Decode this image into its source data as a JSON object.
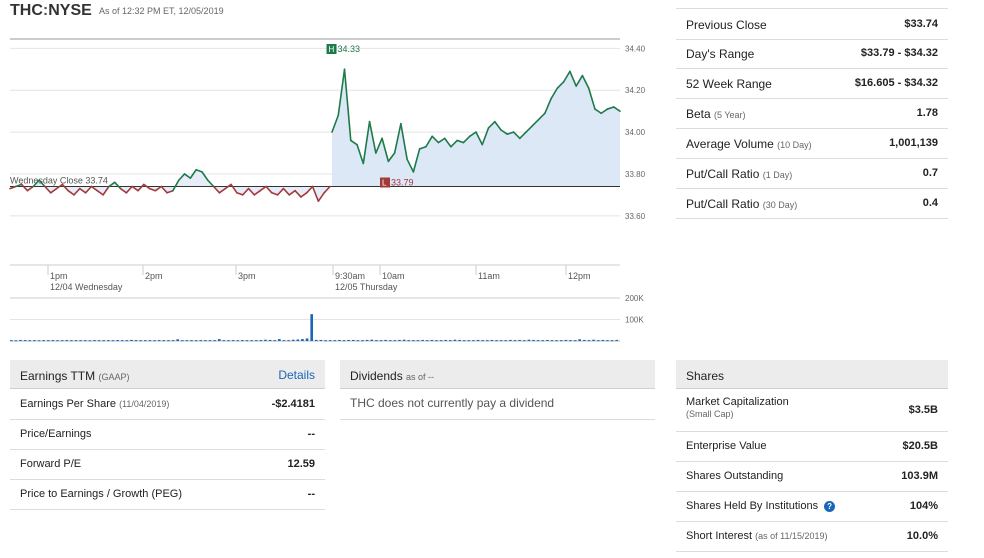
{
  "header": {
    "symbol": "THC",
    "separator": ":",
    "exchange": "NYSE",
    "as_of": "As of 12:32 PM ET, 12/05/2019"
  },
  "chart_data": {
    "type": "line",
    "title": "",
    "y_ticks": [
      "34.40",
      "34.20",
      "34.00",
      "33.80",
      "33.60"
    ],
    "ylim": [
      33.58,
      34.44
    ],
    "previous_close": 33.74,
    "previous_close_label": "Wednesday Close 33.74",
    "high_label": "34.33",
    "high_marker": "H",
    "low_label": "33.79",
    "low_marker": "L",
    "x_labels": [
      {
        "time": "1pm",
        "sub": "12/04 Wednesday"
      },
      {
        "time": "2pm",
        "sub": ""
      },
      {
        "time": "3pm",
        "sub": ""
      },
      {
        "time": "9:30am",
        "sub": "12/05 Thursday"
      },
      {
        "time": "10am",
        "sub": ""
      },
      {
        "time": "11am",
        "sub": ""
      },
      {
        "time": "12pm",
        "sub": ""
      }
    ],
    "series": [
      {
        "values": [
          33.73,
          33.74,
          33.75,
          33.72,
          33.74,
          33.77,
          33.74,
          33.71,
          33.73,
          33.75,
          33.72,
          33.7,
          33.73,
          33.71,
          33.74,
          33.72,
          33.7,
          33.74,
          33.76,
          33.73,
          33.71,
          33.74,
          33.72,
          33.75,
          33.73,
          33.72,
          33.74,
          33.71,
          33.72,
          33.77,
          33.8,
          33.78,
          33.82,
          33.81,
          33.77,
          33.74,
          33.71,
          33.73,
          33.75,
          33.71,
          33.7,
          33.73,
          33.7,
          33.72,
          33.74,
          33.71,
          33.7,
          33.73,
          33.7,
          33.72,
          33.69,
          33.71,
          33.74,
          33.67,
          33.71,
          33.74
        ]
      },
      {
        "values": [
          34.0,
          34.08,
          34.3,
          33.96,
          33.94,
          33.85,
          34.05,
          33.9,
          33.97,
          33.86,
          33.9,
          34.04,
          33.87,
          33.81,
          33.92,
          33.93,
          33.98,
          33.95,
          33.97,
          33.93,
          33.96,
          33.95,
          33.98,
          34.0,
          33.94,
          34.02,
          34.05,
          34.01,
          33.99,
          34.0,
          33.97,
          34.0,
          34.03,
          34.06,
          34.09,
          34.16,
          34.21,
          34.24,
          34.29,
          34.22,
          34.27,
          34.21,
          34.11,
          34.09,
          34.11,
          34.12,
          34.1
        ]
      }
    ],
    "volume_ticks": [
      "200K",
      "100K"
    ],
    "volume_ylim": [
      0,
      200000
    ],
    "volume_values": [
      4000,
      3500,
      5000,
      4200,
      3800,
      4000,
      3600,
      4100,
      3900,
      4300,
      3700,
      4000,
      4200,
      3800,
      4100,
      3900,
      4000,
      3600,
      4200,
      3800,
      4000,
      4100,
      3900,
      4400,
      3800,
      4000,
      5200,
      4200,
      3900,
      4100,
      4000,
      3800,
      4300,
      4100,
      3900,
      4200,
      8000,
      3800,
      4000,
      4100,
      3900,
      4200,
      4000,
      3800,
      4100,
      9000,
      4000,
      3900,
      4200,
      3800,
      4300,
      4000,
      3900,
      4100,
      4200,
      6000,
      5000,
      4000,
      9000,
      4000,
      4000,
      6000,
      7000,
      9000,
      12000,
      125000,
      5000,
      5000,
      4000,
      4000,
      4000,
      5000,
      4000,
      5000,
      5000,
      4000,
      4000,
      5000,
      6000,
      4000,
      4000,
      5000,
      4000,
      4000,
      5000,
      6000,
      4000,
      4000,
      4000,
      5000,
      4000,
      5000,
      4000,
      4000,
      5000,
      4000,
      6000,
      5000,
      4000,
      4000,
      4000,
      5000,
      4000,
      4000,
      5000,
      4000,
      4000,
      4000,
      5000,
      4000,
      5000,
      4000,
      6000,
      5000,
      4000,
      4000,
      5000,
      4000,
      4000,
      4000,
      5000,
      4000,
      4000,
      8000,
      5000,
      4000,
      6000,
      4000,
      5000,
      4000,
      4000,
      5000
    ]
  },
  "stats": [
    {
      "label": "Previous Close",
      "sub": "",
      "value": "$33.74"
    },
    {
      "label": "Day's Range",
      "sub": "",
      "value": "$33.79 - $34.32"
    },
    {
      "label": "52 Week Range",
      "sub": "",
      "value": "$16.605 - $34.32"
    },
    {
      "label": "Beta",
      "sub": "(5 Year)",
      "value": "1.78"
    },
    {
      "label": "Average Volume",
      "sub": "(10 Day)",
      "value": "1,001,139"
    },
    {
      "label": "Put/Call Ratio",
      "sub": "(1 Day)",
      "value": "0.7"
    },
    {
      "label": "Put/Call Ratio",
      "sub": "(30 Day)",
      "value": "0.4"
    }
  ],
  "earnings": {
    "title": "Earnings TTM",
    "title_sub": "(GAAP)",
    "details_link": "Details",
    "rows": [
      {
        "label": "Earnings Per Share",
        "sub": "(11/04/2019)",
        "value": "-$2.4181"
      },
      {
        "label": "Price/Earnings",
        "sub": "",
        "value": "--"
      },
      {
        "label": "Forward P/E",
        "sub": "",
        "value": "12.59"
      },
      {
        "label": "Price to Earnings / Growth (PEG)",
        "sub": "",
        "value": "--"
      }
    ]
  },
  "dividends": {
    "title": "Dividends",
    "title_sub": "as of --",
    "message": "THC does not currently pay a dividend"
  },
  "shares": {
    "title": "Shares",
    "rows": [
      {
        "label": "Market Capitalization",
        "sub": "(Small Cap)",
        "value": "$3.5B"
      },
      {
        "label": "Enterprise Value",
        "sub": "",
        "value": "$20.5B"
      },
      {
        "label": "Shares Outstanding",
        "sub": "",
        "value": "103.9M"
      },
      {
        "label": "Shares Held By Institutions",
        "sub": "",
        "value": "104%",
        "help_icon": "?"
      },
      {
        "label": "Short Interest",
        "sub": "(as of 11/15/2019)",
        "value": "10.0%"
      }
    ]
  }
}
